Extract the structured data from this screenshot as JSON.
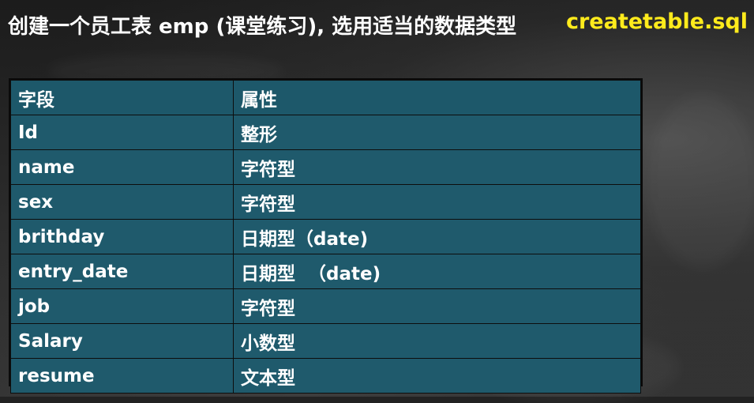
{
  "title": "创建一个员工表 emp (课堂练习), 选用适当的数据类型",
  "filename": "createtable.sql",
  "colors": {
    "title": "#ffffff",
    "filename": "#ffeb1c",
    "table_bg": "#1f5a6c",
    "table_border": "#0d0d0d",
    "background": "#2a2a2a"
  },
  "table": {
    "headers": [
      "字段",
      "属性"
    ],
    "rows": [
      [
        "Id",
        "整形"
      ],
      [
        "name",
        "字符型"
      ],
      [
        "sex",
        "字符型"
      ],
      [
        "brithday",
        "日期型（date)"
      ],
      [
        "entry_date",
        "日期型  （date)"
      ],
      [
        "job",
        "字符型"
      ],
      [
        "Salary",
        "小数型"
      ],
      [
        "resume",
        "文本型"
      ]
    ]
  }
}
